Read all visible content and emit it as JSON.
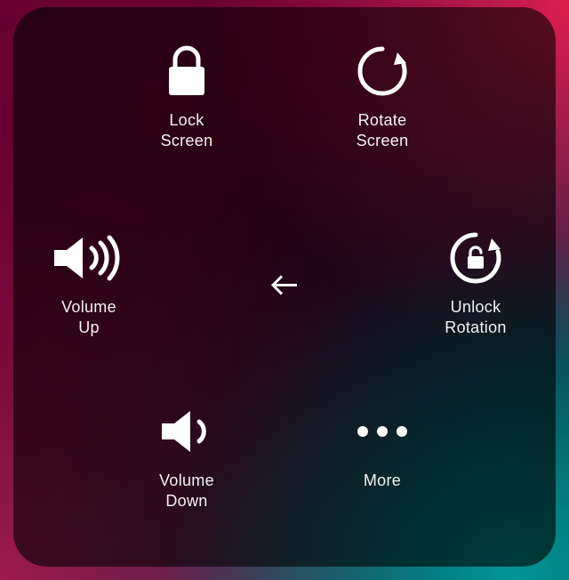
{
  "items": {
    "lock": {
      "label": "Lock\nScreen"
    },
    "rotate": {
      "label": "Rotate\nScreen"
    },
    "volup": {
      "label": "Volume\nUp"
    },
    "unlockr": {
      "label": "Unlock\nRotation"
    },
    "voldown": {
      "label": "Volume\nDown"
    },
    "more": {
      "label": "More"
    }
  }
}
